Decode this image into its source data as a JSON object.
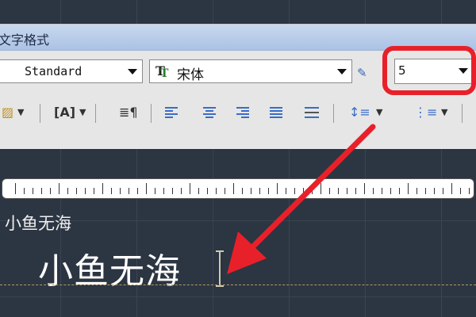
{
  "dialog": {
    "title": "文字格式",
    "style": {
      "value": "Standard"
    },
    "font": {
      "value": "宋体"
    },
    "text_height": {
      "value": "5"
    }
  },
  "editor": {
    "label_text": "小鱼无海",
    "content_text": "小鱼无海"
  },
  "colors": {
    "highlight": "#e8202a",
    "titlebar": "#b7cbe8",
    "canvas": "#2c3542"
  },
  "icons": [
    "color-icon",
    "insert-field-icon",
    "paragraph-icon",
    "align-left-icon",
    "align-center-icon",
    "align-right-icon",
    "justify-icon",
    "distribute-icon",
    "line-spacing-icon",
    "numbering-icon",
    "pen-icon"
  ]
}
